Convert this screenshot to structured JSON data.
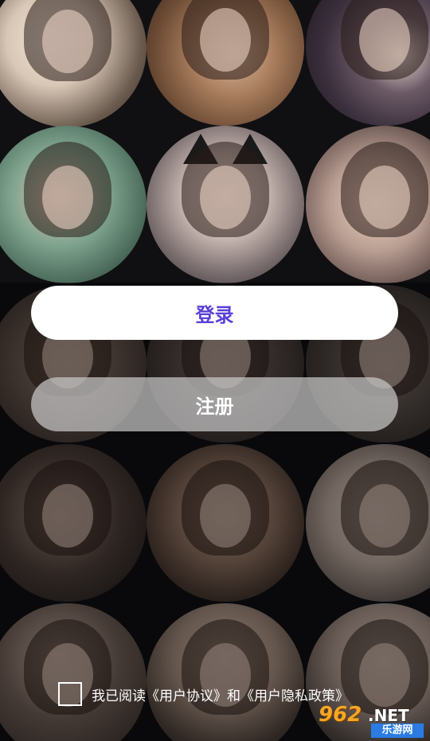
{
  "buttons": {
    "login_label": "登录",
    "register_label": "注册"
  },
  "agreement": {
    "prefix": "我已阅读",
    "user_agreement": "《用户协议》",
    "conjunction": "和",
    "privacy_policy": "《用户隐私政策》",
    "checked": false
  },
  "watermark": {
    "number": "962",
    "suffix": ".NET",
    "sub": "乐游网"
  },
  "colors": {
    "login_text": "#5b3fd6",
    "login_bg": "#ffffff",
    "register_bg": "#c8c8c8",
    "background": "#101012"
  }
}
